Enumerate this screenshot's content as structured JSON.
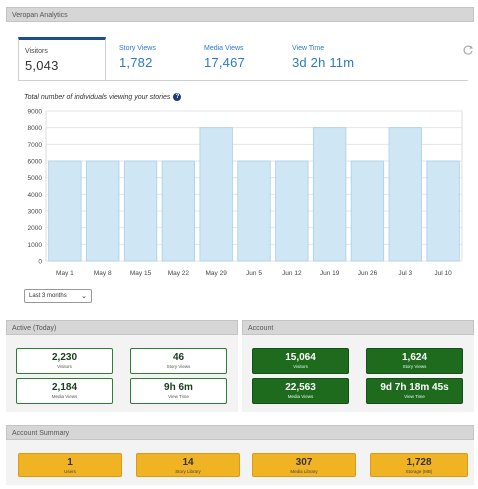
{
  "analytics": {
    "header": "Veropan Analytics",
    "tabs": [
      {
        "label": "Visitors",
        "value": "5,043",
        "active": true
      },
      {
        "label": "Story Views",
        "value": "1,782",
        "active": false
      },
      {
        "label": "Media Views",
        "value": "17,467",
        "active": false
      },
      {
        "label": "View Time",
        "value": "3d 2h 11m",
        "active": false
      }
    ],
    "refresh_icon": "refresh-icon",
    "chart_caption": "Total number of individuals viewing your stories",
    "help_icon": "question-circle-icon",
    "range_select": "Last 3 months",
    "chart_data": {
      "type": "bar",
      "title": "",
      "xlabel": "",
      "ylabel": "",
      "categories": [
        "May 1",
        "May 8",
        "May 15",
        "May 22",
        "May 29",
        "Jun 5",
        "Jun 12",
        "Jun 19",
        "Jun 26",
        "Jul 3",
        "Jul 10"
      ],
      "values": [
        6000,
        6000,
        6000,
        6000,
        8000,
        6000,
        6000,
        8000,
        6000,
        8000,
        6000
      ],
      "ylim": [
        0,
        9000
      ],
      "yticks": [
        "0",
        "1000",
        "2000",
        "3000",
        "4000",
        "5000",
        "6000",
        "7000",
        "8000",
        "9000"
      ],
      "grid": true,
      "bar_color": "#cfe6f5",
      "bar_border": "#a9cfe8"
    }
  },
  "active": {
    "header": "Active (Today)",
    "stats": [
      {
        "value": "2,230",
        "label": "Visitors"
      },
      {
        "value": "46",
        "label": "Story Views"
      },
      {
        "value": "2,184",
        "label": "Media Views"
      },
      {
        "value": "9h 6m",
        "label": "View Time"
      }
    ]
  },
  "account": {
    "header": "Account",
    "stats": [
      {
        "value": "15,064",
        "label": "Visitors"
      },
      {
        "value": "1,624",
        "label": "Story Views"
      },
      {
        "value": "22,563",
        "label": "Media Views"
      },
      {
        "value": "9d 7h 18m 45s",
        "label": "View Time"
      }
    ]
  },
  "summary": {
    "header": "Account Summary",
    "stats": [
      {
        "value": "1",
        "label": "Users"
      },
      {
        "value": "14",
        "label": "Story Library"
      },
      {
        "value": "307",
        "label": "Media Library"
      },
      {
        "value": "1,728",
        "label": "Storage (MB)"
      }
    ]
  },
  "colors": {
    "accent_blue": "#2a79c9",
    "tab_active_border": "#1f4e8f",
    "green_dark": "#1e6b1e",
    "green_outline": "#2e7d32",
    "orange": "#f0b323"
  }
}
